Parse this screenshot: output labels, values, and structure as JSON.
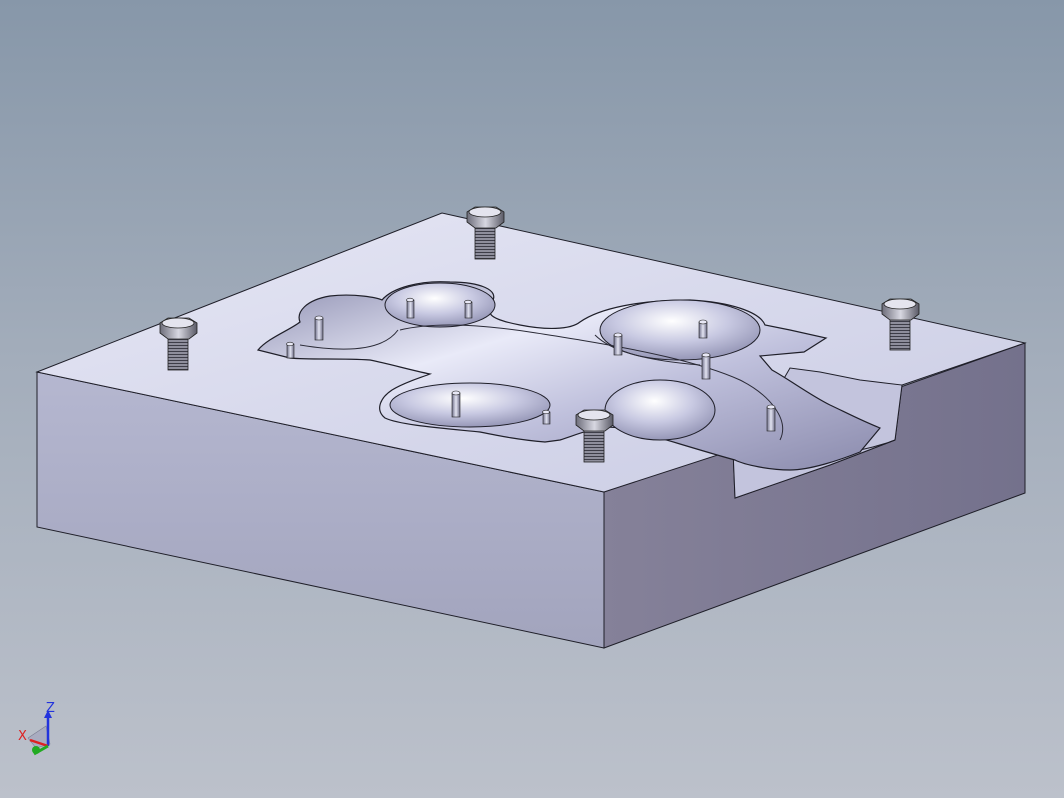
{
  "viewport": {
    "background_top": "#8797a9",
    "background_bottom": "#bcc1cb"
  },
  "model": {
    "face_top_color": "#d6d8ec",
    "face_front_color": "#abadc6",
    "face_side_color": "#7b7894",
    "cavity_color": "#b9bad6",
    "edge_color": "#1f1f29",
    "bolt_count": 4,
    "guide_pin_count": 10
  },
  "triad": {
    "z_label": "Z",
    "x_label": "X",
    "z_color": "#2233dd",
    "x_color": "#dd2222",
    "y_color": "#22aa22"
  }
}
